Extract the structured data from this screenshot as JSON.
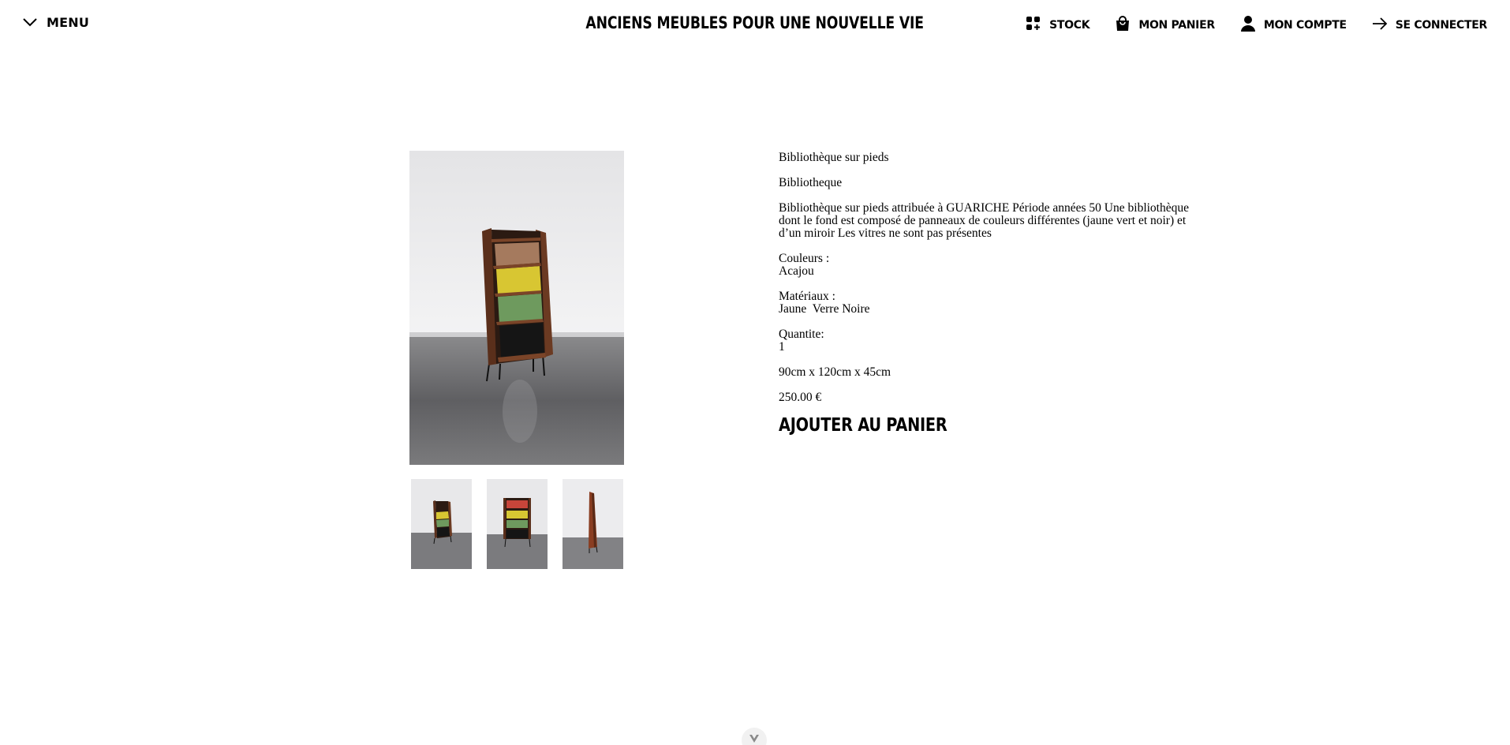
{
  "header": {
    "menu_label": "MENU",
    "site_title": "ANCIENS MEUBLES POUR UNE NOUVELLE VIE",
    "nav": {
      "stock": "STOCK",
      "cart": "MON PANIER",
      "account": "MON COMPTE",
      "login": "SE CONNECTER"
    }
  },
  "product": {
    "title": "Bibliothèque sur pieds",
    "category": "Bibliotheque",
    "description": "Bibliothèque sur pieds attribuée à GUARICHE Période années 50 Une bibliothèque dont le fond est composé de panneaux de couleurs différentes (jaune vert et noir) et d’un miroir Les vitres ne sont pas présentes",
    "colors_label": "Couleurs :",
    "colors_value": "Acajou",
    "materials_label": "Matériaux :",
    "materials_value": "Jaune  Verre Noire",
    "quantity_label": "Quantite:",
    "quantity_value": "1",
    "dimensions": "90cm x 120cm x 45cm",
    "price": "250.00 €",
    "add_to_cart": "AJOUTER AU PANIER"
  },
  "gallery": {
    "thumbnails": [
      "front-view",
      "front-closeup",
      "side-view"
    ]
  },
  "icons": {
    "menu": "chevron-down-icon",
    "stock": "grid-plus-icon",
    "cart": "shopping-bag-icon",
    "account": "person-icon",
    "login": "arrow-right-icon",
    "scroll": "triangle-down-icon"
  },
  "colors": {
    "text": "#000000",
    "background": "#ffffff",
    "wood": "#6b3a22",
    "panel_yellow": "#d8c632",
    "panel_green": "#6e9a5e",
    "panel_black": "#151515"
  }
}
